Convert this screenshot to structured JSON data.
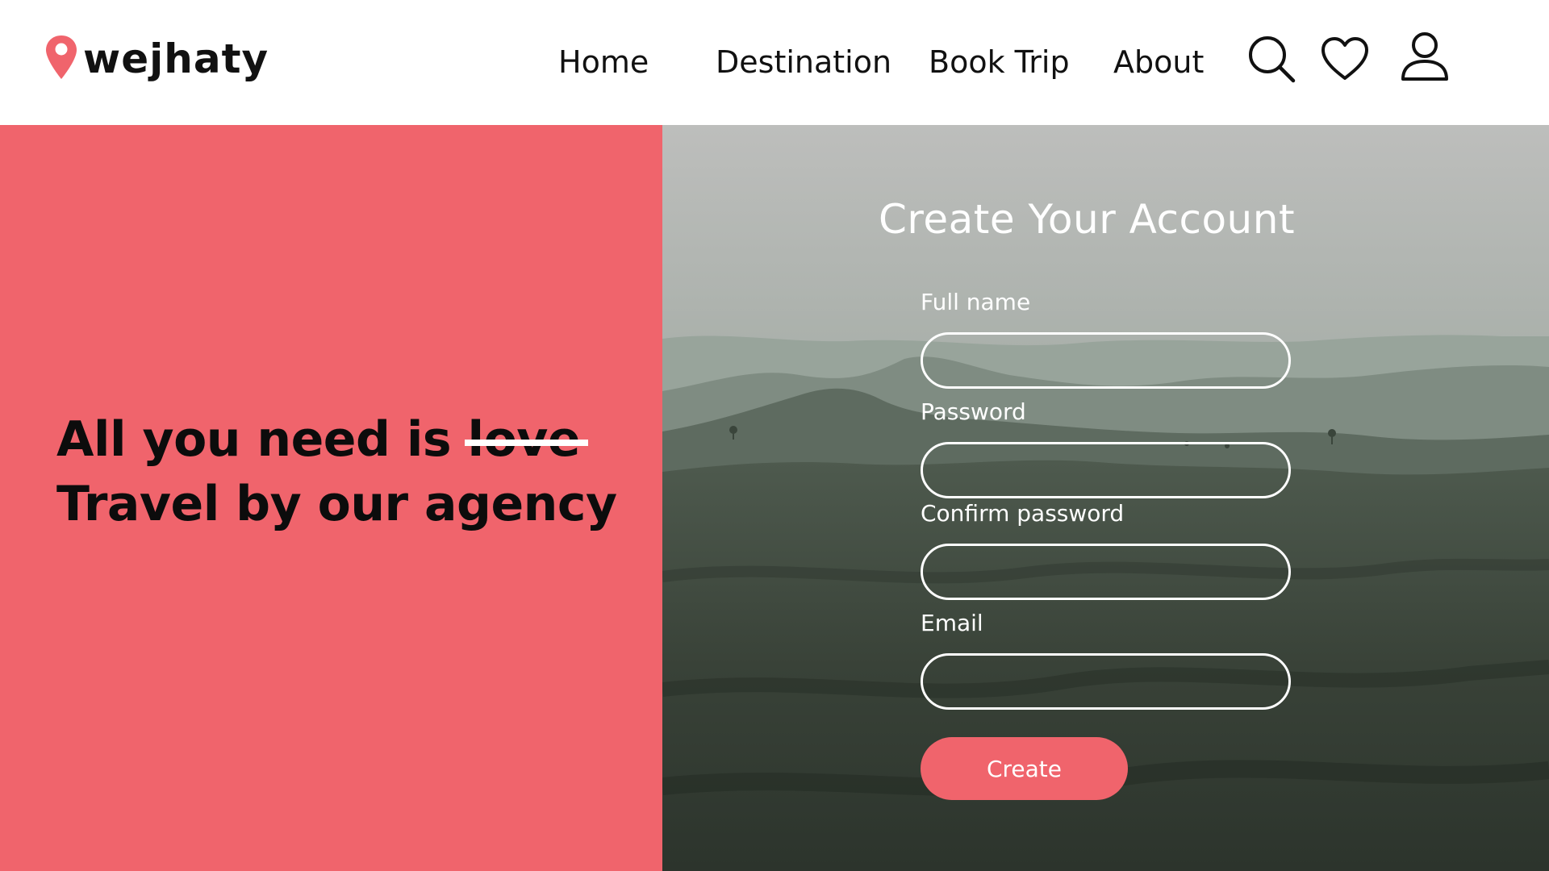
{
  "header": {
    "logo_text": "wejhaty",
    "nav": [
      {
        "label": "Home"
      },
      {
        "label": "Destination"
      },
      {
        "label": "Book Trip"
      },
      {
        "label": "About"
      }
    ],
    "icons": [
      "search-icon",
      "heart-icon",
      "user-icon"
    ]
  },
  "promo": {
    "line1_prefix": "All you need is ",
    "line1_struck": "love",
    "line2": "Travel by our agency"
  },
  "form": {
    "title": "Create Your Account",
    "fields": [
      {
        "label": "Full name",
        "value": ""
      },
      {
        "label": "Password",
        "value": ""
      },
      {
        "label": "Confirm password",
        "value": ""
      },
      {
        "label": "Email",
        "value": ""
      }
    ],
    "submit_label": "Create"
  },
  "colors": {
    "accent": "#f0646c",
    "text_dark": "#111111",
    "white": "#ffffff"
  }
}
